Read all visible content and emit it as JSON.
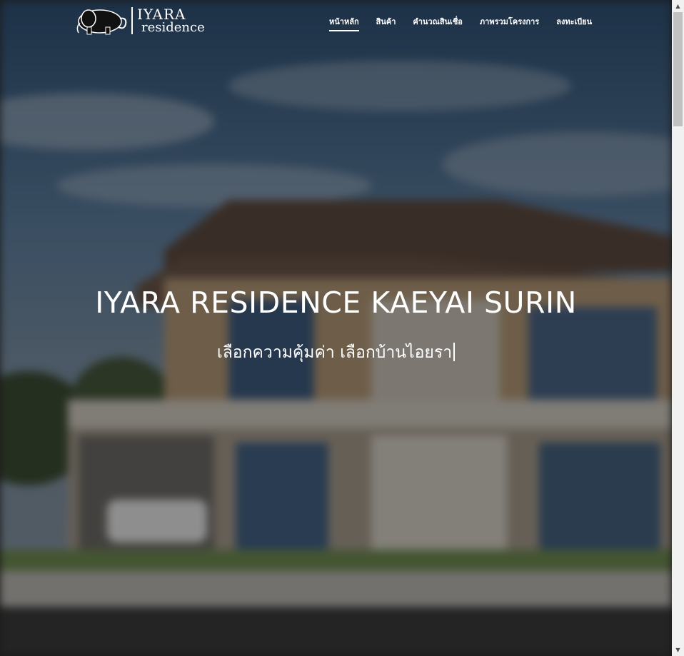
{
  "header": {
    "logo": {
      "line1": "IYARA",
      "line2": "residence"
    },
    "nav": [
      {
        "label": "หน้าหลัก",
        "active": true
      },
      {
        "label": "สินค้า",
        "active": false
      },
      {
        "label": "คำนวณสินเชื่อ",
        "active": false
      },
      {
        "label": "ภาพรวมโครงการ",
        "active": false
      },
      {
        "label": "ลงทะเบียน",
        "active": false
      }
    ]
  },
  "hero": {
    "title": "IYARA RESIDENCE KAEYAI SURIN",
    "subtitle": "เลือกความคุ้มค่า เลือกบ้านไอยรา"
  },
  "scrollbar": {
    "position_fraction": 0.0
  }
}
